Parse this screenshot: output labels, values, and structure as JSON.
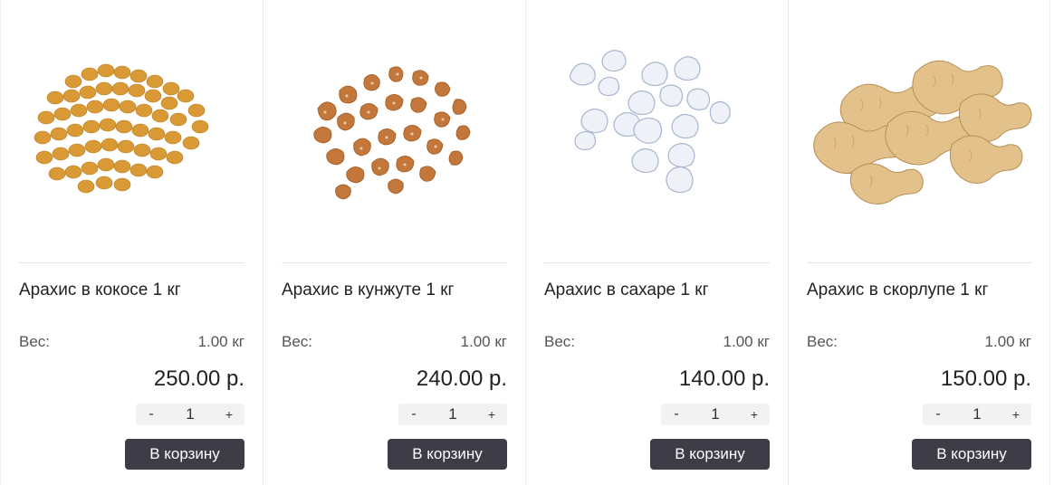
{
  "products": [
    {
      "name": "Арахис в кокосе 1 кг",
      "weight_label": "Вес:",
      "weight": "1.00 кг",
      "price": "250.00 р.",
      "minus": "-",
      "qty": "1",
      "plus": "+",
      "cart_label": "В корзину"
    },
    {
      "name": "Арахис в кунжуте 1 кг",
      "weight_label": "Вес:",
      "weight": "1.00 кг",
      "price": "240.00 р.",
      "minus": "-",
      "qty": "1",
      "plus": "+",
      "cart_label": "В корзину"
    },
    {
      "name": "Арахис в сахаре 1 кг",
      "weight_label": "Вес:",
      "weight": "1.00 кг",
      "price": "140.00 р.",
      "minus": "-",
      "qty": "1",
      "plus": "+",
      "cart_label": "В корзину"
    },
    {
      "name": "Арахис в скорлупе 1 кг",
      "weight_label": "Вес:",
      "weight": "1.00 кг",
      "price": "150.00 р.",
      "minus": "-",
      "qty": "1",
      "plus": "+",
      "cart_label": "В корзину"
    }
  ],
  "colors": {
    "cart_button": "#3e3c47",
    "qty_bg": "#f2f2f2",
    "divider": "#e3e3e3"
  }
}
